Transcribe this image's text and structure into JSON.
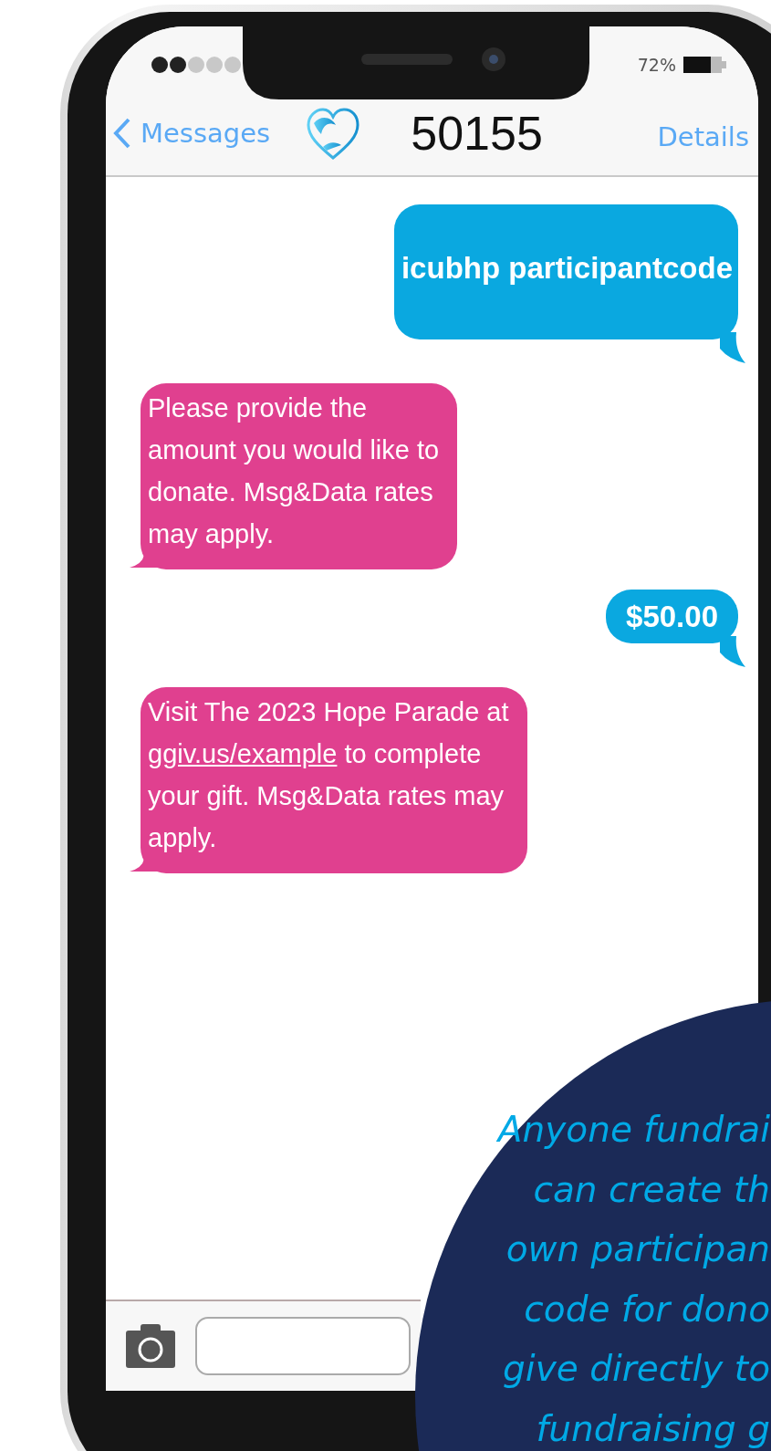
{
  "status_bar": {
    "battery": "72%"
  },
  "nav": {
    "back": "Messages",
    "title": "50155",
    "action": "Details"
  },
  "messages": [
    {
      "kind": "sent",
      "lines": [
        [
          {
            "kind": "text",
            "text": "icubhp participantcode"
          }
        ]
      ]
    },
    {
      "kind": "received",
      "lines": [
        [
          {
            "kind": "text",
            "text": "Please provide the"
          }
        ],
        [
          {
            "kind": "text",
            "text": "amount you would like to"
          }
        ],
        [
          {
            "kind": "text",
            "text": "donate. Msg&Data rates"
          }
        ],
        [
          {
            "kind": "text",
            "text": "may apply."
          }
        ]
      ]
    },
    {
      "kind": "sent",
      "lines": [
        [
          {
            "kind": "text",
            "text": "$50.00"
          }
        ]
      ]
    },
    {
      "kind": "received",
      "lines": [
        [
          {
            "kind": "text",
            "text": "Visit The 2023 Hope Parade at"
          }
        ],
        [
          {
            "kind": "link",
            "text": "ggiv.us/example"
          },
          {
            "kind": "text",
            "text": " to complete"
          }
        ],
        [
          {
            "kind": "text",
            "text": "your gift. Msg&Data rates may"
          }
        ],
        [
          {
            "kind": "text",
            "text": "apply."
          }
        ]
      ]
    }
  ],
  "callout": {
    "lines": [
      "Anyone fundrai",
      "can create th",
      "own participan",
      "code for dono",
      "give directly to",
      "fundraising g"
    ]
  }
}
